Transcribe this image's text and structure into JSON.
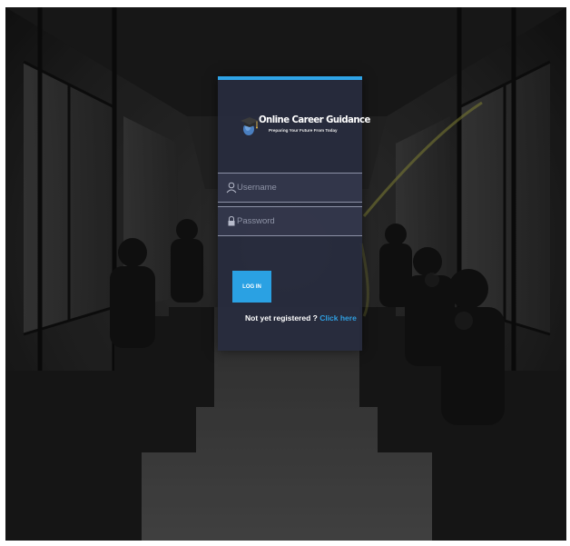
{
  "logo": {
    "title": "Online Career Guidance",
    "tagline": "Preparing Your Future From Today",
    "icon": "graduation-cap-icon"
  },
  "form": {
    "username_placeholder": "Username",
    "password_placeholder": "Password",
    "username_icon": "user-icon",
    "password_icon": "lock-icon",
    "login_label": "LOG IN"
  },
  "register": {
    "prompt": "Not yet registered ? ",
    "link_label": "Click here"
  },
  "colors": {
    "accent": "#2aa1e3",
    "card_bg": "#282c3e",
    "link": "#2f9ee0"
  }
}
